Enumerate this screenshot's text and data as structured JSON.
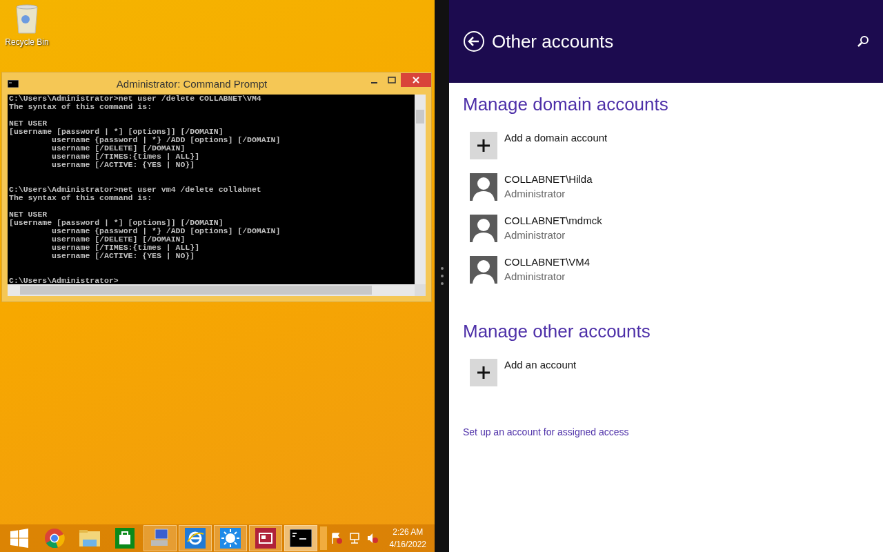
{
  "desktop": {
    "icons": [
      {
        "label": "Recycle Bin"
      }
    ]
  },
  "console_window": {
    "title": "Administrator: Command Prompt",
    "commands": [
      {
        "paragraphs": [
          [
            "C:\\Users\\Administrator>net user /delete COLLABNET\\VM4",
            "The syntax of this command is:"
          ],
          [
            "NET USER",
            "[username [password | *] [options]] [/DOMAIN]",
            "         username {password | *} /ADD [options] [/DOMAIN]",
            "         username [/DELETE] [/DOMAIN]",
            "         username [/TIMES:{times | ALL}]",
            "         username [/ACTIVE: {YES | NO}]"
          ]
        ]
      },
      {
        "paragraphs": [
          [
            "C:\\Users\\Administrator>net user vm4 /delete collabnet",
            "The syntax of this command is:"
          ],
          [
            "NET USER",
            "[username [password | *] [options]] [/DOMAIN]",
            "         username {password | *} /ADD [options] [/DOMAIN]",
            "         username [/DELETE] [/DOMAIN]",
            "         username [/TIMES:{times | ALL}]",
            "         username [/ACTIVE: {YES | NO}]"
          ]
        ]
      },
      {
        "paragraphs": [
          [
            "C:\\Users\\Administrator>"
          ]
        ]
      }
    ]
  },
  "taskbar": {
    "items": [
      {
        "kind": "start",
        "running": false,
        "active": false
      },
      {
        "kind": "chrome",
        "running": false,
        "active": false
      },
      {
        "kind": "explorer",
        "running": false,
        "active": false
      },
      {
        "kind": "store",
        "running": false,
        "active": false
      },
      {
        "kind": "network",
        "running": true,
        "active": false
      },
      {
        "kind": "ie",
        "running": true,
        "active": false
      },
      {
        "kind": "sun",
        "running": true,
        "active": false
      },
      {
        "kind": "news",
        "running": true,
        "active": false
      },
      {
        "kind": "cmd",
        "running": true,
        "active": true
      }
    ],
    "clock": {
      "time": "2:26 AM",
      "date": "4/16/2022"
    }
  },
  "settings": {
    "title": "Other accounts",
    "sections": [
      {
        "heading": "Manage domain accounts",
        "items": [
          {
            "kind": "add",
            "name": "Add a domain account"
          },
          {
            "kind": "user",
            "name": "COLLABNET\\Hilda",
            "role": "Administrator"
          },
          {
            "kind": "user",
            "name": "COLLABNET\\mdmck",
            "role": "Administrator"
          },
          {
            "kind": "user",
            "name": "COLLABNET\\VM4",
            "role": "Administrator"
          }
        ]
      },
      {
        "heading": "Manage other accounts",
        "items": [
          {
            "kind": "add",
            "name": "Add an account"
          }
        ]
      }
    ],
    "link": "Set up an account for assigned access"
  }
}
